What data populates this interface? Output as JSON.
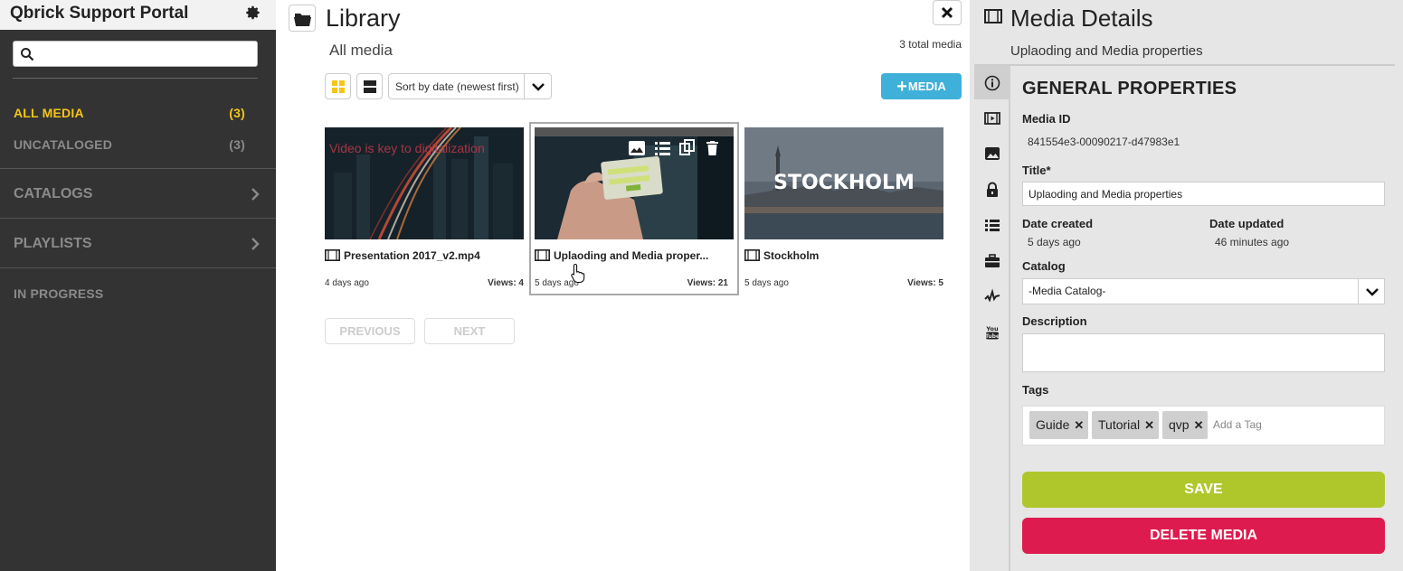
{
  "sidebar": {
    "title": "Qbrick Support Portal",
    "search_placeholder": "",
    "items": [
      {
        "label": "ALL MEDIA",
        "count": "(3)"
      },
      {
        "label": "UNCATALOGED",
        "count": "(3)"
      }
    ],
    "sections": [
      {
        "label": "CATALOGS"
      },
      {
        "label": "PLAYLISTS"
      },
      {
        "label": "IN PROGRESS"
      }
    ],
    "active_color": "#f5c518"
  },
  "library": {
    "title": "Library",
    "subtitle": "All media",
    "total": "3 total media",
    "sort_label": "Sort by date (newest first)",
    "add_label": "MEDIA",
    "cards": [
      {
        "name": "Presentation 2017_v2.mp4",
        "date": "4 days ago",
        "views": "Views: 4",
        "overlay": "Video is key to digitalization"
      },
      {
        "name": "Uplaoding and Media proper...",
        "date": "5 days ago",
        "views": "Views: 21"
      },
      {
        "name": "Stockholm",
        "date": "5 days ago",
        "views": "Views: 5",
        "overlay": "STOCKHOLM"
      }
    ],
    "prev_label": "PREVIOUS",
    "next_label": "NEXT",
    "accent": "#3fb0d9"
  },
  "details": {
    "title": "Media Details",
    "subtitle": "Uplaoding and Media properties",
    "section_title": "GENERAL PROPERTIES",
    "media_id_label": "Media ID",
    "media_id": "841554e3-00090217-d47983e1",
    "title_label": "Title*",
    "title_value": "Uplaoding and Media properties",
    "date_created_label": "Date created",
    "date_created": "5 days ago",
    "date_updated_label": "Date updated",
    "date_updated": "46 minutes ago",
    "catalog_label": "Catalog",
    "catalog_value": "-Media Catalog-",
    "description_label": "Description",
    "tags_label": "Tags",
    "tags": [
      "Guide",
      "Tutorial",
      "qvp"
    ],
    "tag_placeholder": "Add a Tag",
    "save_label": "SAVE",
    "delete_label": "DELETE MEDIA",
    "save_color": "#b0c72c",
    "delete_color": "#de1b4e"
  }
}
